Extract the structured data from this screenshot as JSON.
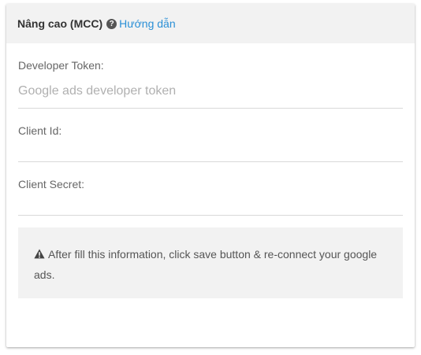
{
  "header": {
    "title": "Nâng cao (MCC)",
    "help_link": "Hướng dẫn"
  },
  "fields": {
    "developer_token": {
      "label": "Developer Token:",
      "placeholder": "Google ads developer token",
      "value": ""
    },
    "client_id": {
      "label": "Client Id:",
      "placeholder": "",
      "value": ""
    },
    "client_secret": {
      "label": "Client Secret:",
      "placeholder": "",
      "value": ""
    }
  },
  "notice": {
    "icon": "warning-icon",
    "text": "After fill this information, click save button & re-connect your google ads."
  },
  "colors": {
    "link": "#2a8fd6",
    "header_bg": "#f2f2f2",
    "notice_bg": "#f2f2f2"
  }
}
